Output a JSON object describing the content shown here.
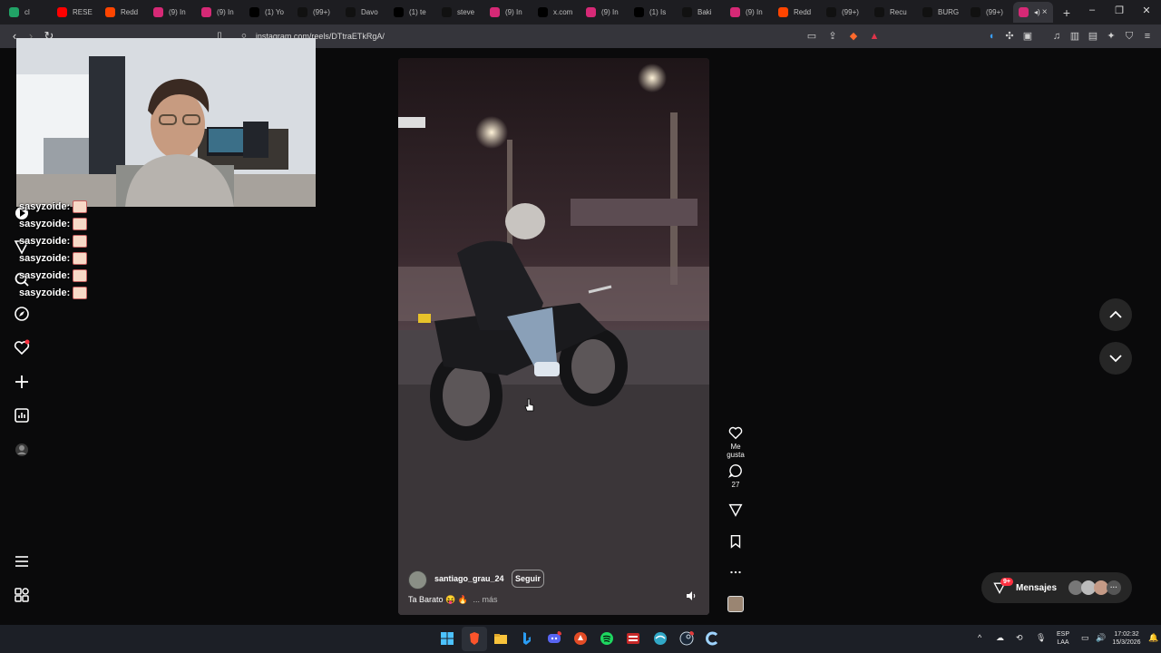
{
  "browser": {
    "tabs": [
      {
        "label": "cl",
        "icon": "spreadsheet-icon",
        "color": "#21a366"
      },
      {
        "label": "RESE",
        "icon": "youtube-icon",
        "color": "#ff0000"
      },
      {
        "label": "Redd",
        "icon": "reddit-icon",
        "color": "#ff4500"
      },
      {
        "label": "(9) In",
        "icon": "instagram-icon",
        "color": "#d62976"
      },
      {
        "label": "(9) In",
        "icon": "instagram-icon",
        "color": "#d62976"
      },
      {
        "label": "(1) Yo",
        "icon": "x-icon",
        "color": "#000000"
      },
      {
        "label": "(99+)",
        "icon": "tiktok-icon",
        "color": "#111111"
      },
      {
        "label": "Davo",
        "icon": "tiktok-icon",
        "color": "#111111"
      },
      {
        "label": "(1) te",
        "icon": "x-icon",
        "color": "#000000"
      },
      {
        "label": "steve",
        "icon": "tiktok-icon",
        "color": "#111111"
      },
      {
        "label": "(9) In",
        "icon": "instagram-icon",
        "color": "#d62976"
      },
      {
        "label": "x.com",
        "icon": "x-icon",
        "color": "#000000"
      },
      {
        "label": "(9) In",
        "icon": "instagram-icon",
        "color": "#d62976"
      },
      {
        "label": "(1) Is",
        "icon": "x-icon",
        "color": "#000000"
      },
      {
        "label": "Baki",
        "icon": "tiktok-icon",
        "color": "#111111"
      },
      {
        "label": "(9) In",
        "icon": "instagram-icon",
        "color": "#d62976"
      },
      {
        "label": "Redd",
        "icon": "reddit-icon",
        "color": "#ff4500"
      },
      {
        "label": "(99+)",
        "icon": "tiktok-icon",
        "color": "#111111"
      },
      {
        "label": "Recu",
        "icon": "tiktok-icon",
        "color": "#111111"
      },
      {
        "label": "BURG",
        "icon": "tiktok-icon",
        "color": "#111111"
      },
      {
        "label": "(99+)",
        "icon": "tiktok-icon",
        "color": "#111111"
      }
    ],
    "active_tab_close": "×",
    "new_tab": "+",
    "url": "instagram.com/reels/DTtraETkRgA/"
  },
  "chat": {
    "username": "sasyzoide:",
    "line_count_visible": 6
  },
  "reel": {
    "author": "santiago_grau_24",
    "follow_label": "Seguir",
    "caption": "Ta Barato 😝 🔥",
    "more_label": "... más",
    "like_label": "Me gusta",
    "comment_count": "27"
  },
  "messages": {
    "label": "Mensajes",
    "badge": "9+"
  },
  "taskbar": {
    "lang_top": "ESP",
    "lang_bottom": "LAA",
    "time": "17:02:32",
    "date": "15/3/2026",
    "icons": [
      "windows-start-icon",
      "brave-icon",
      "file-explorer-icon",
      "bing-icon",
      "discord-icon",
      "app-icon",
      "spotify-icon",
      "app-icon",
      "browser-icon",
      "steam-icon",
      "app-icon"
    ]
  },
  "colors": {
    "accent_blue": "#0095f6",
    "instagram_red": "#ff3040"
  }
}
